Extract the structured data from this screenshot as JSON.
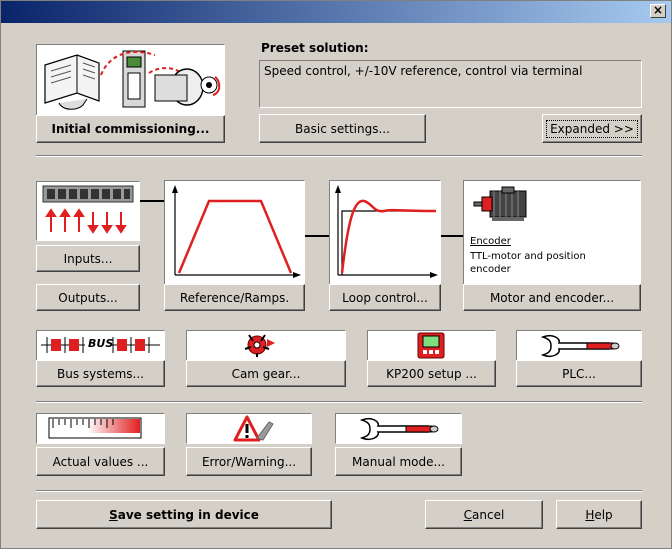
{
  "window": {
    "close_glyph": "×"
  },
  "preset": {
    "label": "Preset solution:",
    "description": "Speed control, +/-10V reference, control via terminal"
  },
  "buttons": {
    "initial_commissioning": "Initial commissioning...",
    "basic_settings": "Basic settings...",
    "expanded": "Expanded >>",
    "inputs": "Inputs...",
    "outputs": "Outputs...",
    "reference_ramps": "Reference/Ramps.",
    "loop_control": "Loop control...",
    "motor_encoder": "Motor and encoder...",
    "bus_systems": "Bus systems...",
    "cam_gear": "Cam gear...",
    "kp200_setup": "KP200 setup ...",
    "plc": "PLC...",
    "actual_values": "Actual values ...",
    "error_warning": "Error/Warning...",
    "manual_mode": "Manual mode...",
    "save_setting_pre": "",
    "save_setting_hot": "S",
    "save_setting_post": "ave setting in device",
    "cancel_hot": "C",
    "cancel_post": "ancel",
    "help_hot": "H",
    "help_post": "elp"
  },
  "encoder": {
    "title": "Encoder",
    "description": "TTL-motor and position encoder"
  },
  "bus_icon_text": "BUS",
  "icons": {
    "commissioning": "commissioning-illustration-icon",
    "terminals": "io-terminal-icon",
    "ramp": "ramp-graph-icon",
    "step_response": "step-response-graph-icon",
    "motor": "motor-icon",
    "bus": "bus-icon",
    "cam": "cam-gear-icon",
    "kp200": "kp200-keypad-icon",
    "wrench": "wrench-icon",
    "meter": "meter-icon",
    "warning": "warning-icon"
  },
  "colors": {
    "dialog_bg": "#d4d0c8",
    "title_start": "#0a246a",
    "title_end": "#a6caf0",
    "accent_red": "#e02020"
  }
}
